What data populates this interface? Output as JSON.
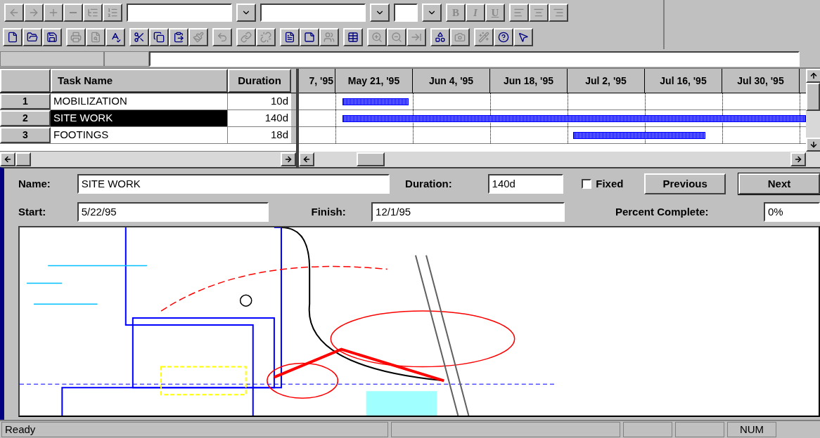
{
  "toolbar_1": {
    "buttons": [
      {
        "kind": "left",
        "disabled": true
      },
      {
        "kind": "right",
        "disabled": true
      },
      {
        "kind": "plus",
        "disabled": true
      },
      {
        "kind": "minus",
        "disabled": true
      },
      {
        "kind": "showall",
        "disabled": true
      },
      {
        "kind": "outline",
        "disabled": true
      }
    ],
    "fields": [
      {
        "kind": "wide"
      },
      {
        "kind": "wide"
      },
      {
        "kind": "narrow"
      }
    ],
    "format_buttons": [
      {
        "label": "B",
        "kind": "bold",
        "disabled": true
      },
      {
        "label": "I",
        "kind": "italic",
        "disabled": true
      },
      {
        "label": "U",
        "kind": "underline",
        "disabled": true
      }
    ],
    "align_buttons": [
      {
        "kind": "left",
        "disabled": true
      },
      {
        "kind": "center",
        "disabled": true
      },
      {
        "kind": "right",
        "disabled": true
      }
    ]
  },
  "toolbar_2": {
    "groups": [
      [
        {
          "kind": "new",
          "disabled": false
        },
        {
          "kind": "open",
          "disabled": false
        },
        {
          "kind": "save",
          "disabled": false
        }
      ],
      [
        {
          "kind": "print",
          "disabled": true
        },
        {
          "kind": "preview",
          "disabled": true
        },
        {
          "kind": "spell",
          "disabled": false
        }
      ],
      [
        {
          "kind": "cut",
          "disabled": false
        },
        {
          "kind": "copy",
          "disabled": false
        },
        {
          "kind": "paste",
          "disabled": false
        },
        {
          "kind": "brush",
          "disabled": true
        }
      ],
      [
        {
          "kind": "undo",
          "disabled": true
        }
      ],
      [
        {
          "kind": "link",
          "disabled": true
        },
        {
          "kind": "unlink",
          "disabled": true
        }
      ],
      [
        {
          "kind": "info",
          "disabled": false
        },
        {
          "kind": "note",
          "disabled": false
        },
        {
          "kind": "assign",
          "disabled": true
        }
      ],
      [
        {
          "kind": "table",
          "disabled": false
        }
      ],
      [
        {
          "kind": "zoomin",
          "disabled": true
        },
        {
          "kind": "zoomout",
          "disabled": true
        },
        {
          "kind": "goto",
          "disabled": true
        }
      ],
      [
        {
          "kind": "shapes",
          "disabled": false
        },
        {
          "kind": "camera",
          "disabled": true
        }
      ],
      [
        {
          "kind": "wand",
          "disabled": true
        },
        {
          "kind": "help",
          "disabled": false
        },
        {
          "kind": "whatsthis",
          "disabled": false
        }
      ]
    ]
  },
  "table": {
    "columns": [
      "Task Name",
      "Duration"
    ],
    "rows": [
      {
        "id": "1",
        "name": "MOBILIZATION",
        "duration": "10d",
        "selected": false
      },
      {
        "id": "2",
        "name": "SITE WORK",
        "duration": "140d",
        "selected": true
      },
      {
        "id": "3",
        "name": "FOOTINGS",
        "duration": "18d",
        "selected": false
      }
    ]
  },
  "gantt": {
    "timescale": [
      "7, '95",
      "May 21, '95",
      "Jun 4, '95",
      "Jun 18, '95",
      "Jul 2, '95",
      "Jul 16, '95",
      "Jul 30, '95"
    ]
  },
  "form": {
    "name_label": "Name:",
    "name": "SITE WORK",
    "duration_label": "Duration:",
    "duration": "140d",
    "fixed": {
      "label": "Fixed",
      "checked": false
    },
    "previous": "Previous",
    "next": "Next",
    "start_label": "Start:",
    "start": "5/22/95",
    "finish_label": "Finish:",
    "finish": "12/1/95",
    "percent_label": "Percent Complete:",
    "percent": "0%"
  },
  "status_bar": {
    "message": "Ready",
    "indicators": [
      "NUM"
    ]
  }
}
